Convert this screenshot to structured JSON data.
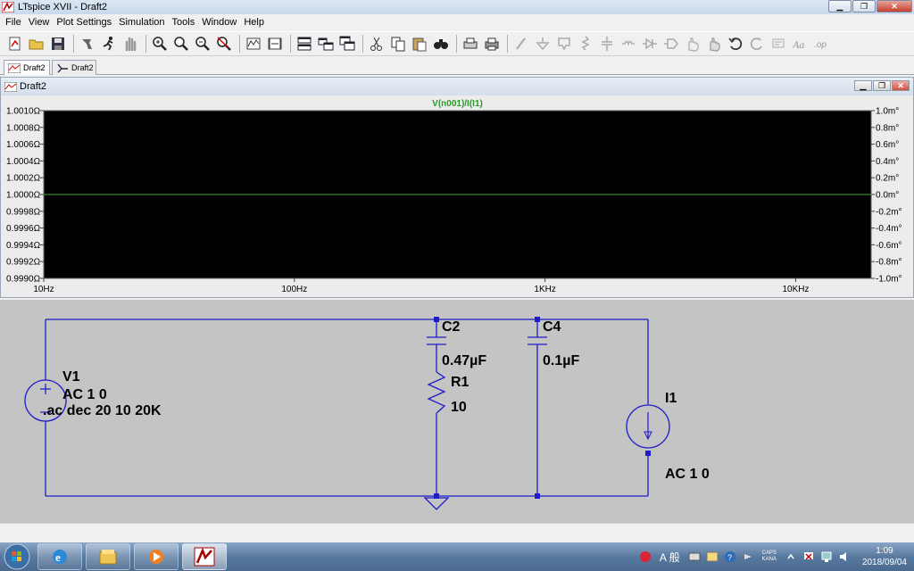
{
  "window": {
    "title": "LTspice XVII - Draft2"
  },
  "menu": [
    "File",
    "View",
    "Plot Settings",
    "Simulation",
    "Tools",
    "Window",
    "Help"
  ],
  "toolbar_icons": [
    "new-schematic-icon",
    "open-icon",
    "save-icon",
    "control-panel-icon",
    "run-icon",
    "halt-icon",
    "zoom-in-icon",
    "zoom-rubber-icon",
    "zoom-out-icon",
    "zoom-fit-icon",
    "autorange-icon",
    "pan-icon",
    "tile-horizontal-icon",
    "tile-vertical-icon",
    "cascade-icon",
    "cut-icon",
    "copy-icon",
    "paste-icon",
    "find-icon",
    "print-setup-icon",
    "print-icon",
    "wire-icon",
    "ground-icon",
    "label-icon",
    "resistor-icon",
    "capacitor-icon",
    "inductor-icon",
    "diode-icon",
    "component-icon",
    "move-icon",
    "drag-icon",
    "undo-icon",
    "redo-icon",
    "rotate-icon",
    "mirror-icon",
    "text-icon",
    "spice-directive-icon"
  ],
  "tabs": [
    {
      "label": "Draft2",
      "active": true
    },
    {
      "label": "Draft2",
      "active": false
    }
  ],
  "plot_window": {
    "title": "Draft2"
  },
  "chart_data": {
    "type": "line",
    "title": "V(n001)/I(I1)",
    "xscale": "log",
    "x_ticks": [
      "10Hz",
      "100Hz",
      "1KHz",
      "10KHz"
    ],
    "x_tick_values": [
      10,
      100,
      1000,
      10000
    ],
    "xlim": [
      10,
      20000
    ],
    "y_ticks_left": [
      "1.0010Ω",
      "1.0008Ω",
      "1.0006Ω",
      "1.0004Ω",
      "1.0002Ω",
      "1.0000Ω",
      "0.9998Ω",
      "0.9996Ω",
      "0.9994Ω",
      "0.9992Ω",
      "0.9990Ω"
    ],
    "y_tick_values_left": [
      1.001,
      1.0008,
      1.0006,
      1.0004,
      1.0002,
      1.0,
      0.9998,
      0.9996,
      0.9994,
      0.9992,
      0.999
    ],
    "ylim_left": [
      0.999,
      1.001
    ],
    "y_ticks_right": [
      "1.0m°",
      "0.8m°",
      "0.6m°",
      "0.4m°",
      "0.2m°",
      "0.0m°",
      "-0.2m°",
      "-0.4m°",
      "-0.6m°",
      "-0.8m°",
      "-1.0m°"
    ],
    "ylim_right": [
      -1.0,
      1.0
    ],
    "series": [
      {
        "name": "V(n001)/I(I1)",
        "color": "#3ea83e",
        "x": [
          10,
          20000
        ],
        "y": [
          1.0,
          1.0
        ]
      }
    ],
    "background": "#000000",
    "grid": false
  },
  "schematic": {
    "background": "#c4c4c4",
    "wire_color": "#1c1cc8",
    "labels": {
      "v1_name": "V1",
      "v1_value": "AC 1 0",
      "directive": ".ac dec 20 10 20K",
      "c2_name": "C2",
      "c2_value": "0.47µF",
      "r1_name": "R1",
      "r1_value": "10",
      "c4_name": "C4",
      "c4_value": "0.1µF",
      "i1_name": "I1",
      "i1_value": "AC 1 0"
    }
  },
  "taskbar": {
    "apps": [
      "ie-icon",
      "explorer-icon",
      "media-player-icon",
      "ltspice-icon"
    ],
    "ime": "A 般",
    "caps": "CAPS",
    "kana": "KANA",
    "time": "1:09",
    "date": "2018/09/04"
  }
}
